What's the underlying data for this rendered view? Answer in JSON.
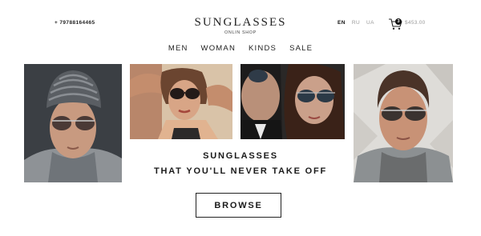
{
  "header": {
    "phone": "+ 79788164465",
    "brand_title": "SUNGLASSES",
    "brand_subtitle": "ONLIN SHOP",
    "languages": [
      {
        "code": "EN",
        "active": true
      },
      {
        "code": "RU",
        "active": false
      },
      {
        "code": "UA",
        "active": false
      }
    ],
    "cart_count": "3",
    "cart_total": "$453.00"
  },
  "nav": {
    "items": [
      {
        "label": "MEN"
      },
      {
        "label": "WOMAN"
      },
      {
        "label": "KINDS"
      },
      {
        "label": "SALE"
      }
    ]
  },
  "hero": {
    "headline_line1": "SUNGLASSES",
    "headline_line2": "THAT YOU'LL NEVER TAKE OFF",
    "browse_label": "BROWSE"
  },
  "icons": {
    "cart": "shopping-cart-icon"
  },
  "colors": {
    "text": "#1a1a1a",
    "muted": "#999999",
    "background": "#ffffff"
  }
}
